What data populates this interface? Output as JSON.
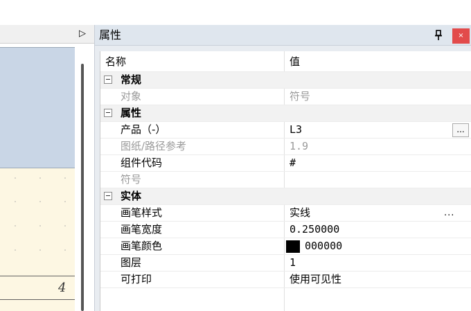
{
  "left_pane": {
    "expand_icon": "triangle-right-icon",
    "canvas_label": "4"
  },
  "panel": {
    "title": "属性",
    "pin_icon": "pin-icon",
    "close_label": "×",
    "columns": {
      "name": "名称",
      "value": "值"
    },
    "categories": [
      {
        "label": "常规",
        "rows": [
          {
            "name": "对象",
            "value": "符号",
            "disabled": true
          }
        ]
      },
      {
        "label": "属性",
        "rows": [
          {
            "name": "产品（-）",
            "value": "L3",
            "button": "..."
          },
          {
            "name": "图纸/路径参考",
            "value": "1.9",
            "disabled": true
          },
          {
            "name": "组件代码",
            "value": "#"
          },
          {
            "name": "符号",
            "value": "",
            "disabled": true
          }
        ]
      },
      {
        "label": "实体",
        "rows": [
          {
            "name": "画笔样式",
            "value": "实线",
            "dots": "..."
          },
          {
            "name": "画笔宽度",
            "value": "0.250000"
          },
          {
            "name": "画笔颜色",
            "value": "000000",
            "swatch_color": "#000000"
          },
          {
            "name": "图层",
            "value": "1"
          },
          {
            "name": "可打印",
            "value": "使用可见性"
          }
        ]
      }
    ]
  }
}
